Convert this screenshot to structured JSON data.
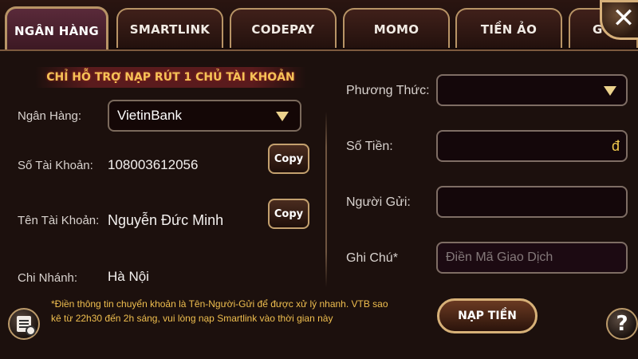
{
  "tabs": [
    {
      "label": "NGÂN HÀNG",
      "active": true
    },
    {
      "label": "SMARTLINK",
      "active": false
    },
    {
      "label": "CODEPAY",
      "active": false
    },
    {
      "label": "MOMO",
      "active": false
    },
    {
      "label": "TIỀN ẢO",
      "active": false
    },
    {
      "label": "G",
      "active": false
    }
  ],
  "close_icon": "close-icon",
  "notice": "CHỈ HỖ TRỢ NẠP RÚT 1 CHỦ TÀI KHOẢN",
  "bank": {
    "label": "Ngân Hàng:",
    "selected": "VietinBank"
  },
  "account_number": {
    "label": "Số Tài Khoản:",
    "value": "108003612056",
    "copy_label": "Copy"
  },
  "account_name": {
    "label": "Tên Tài Khoản:",
    "value": "Nguyễn Đức Minh",
    "copy_label": "Copy"
  },
  "branch": {
    "label": "Chi Nhánh:",
    "value": "Hà Nội"
  },
  "method": {
    "label": "Phương Thức:",
    "selected": ""
  },
  "amount": {
    "label": "Số Tiền:",
    "value": "",
    "currency": "đ"
  },
  "sender": {
    "label": "Người Gửi:",
    "value": ""
  },
  "note": {
    "label": "Ghi Chú*",
    "placeholder": "Điền Mã Giao Dịch"
  },
  "footnote": {
    "line1": "*Điền thông tin chuyển khoản là Tên-Người-Gửi để được xử lý nhanh. VTB sao",
    "line2": "kê từ 22h30 đến 2h sáng, vui lòng nạp Smartlink vào thời gian này"
  },
  "deposit_button": "NẠP TIỀN",
  "help_icon_label": "?",
  "colors": {
    "accent_gold": "#f0bf4f",
    "border_gold": "#c3a06e",
    "background": "#1c100d"
  }
}
